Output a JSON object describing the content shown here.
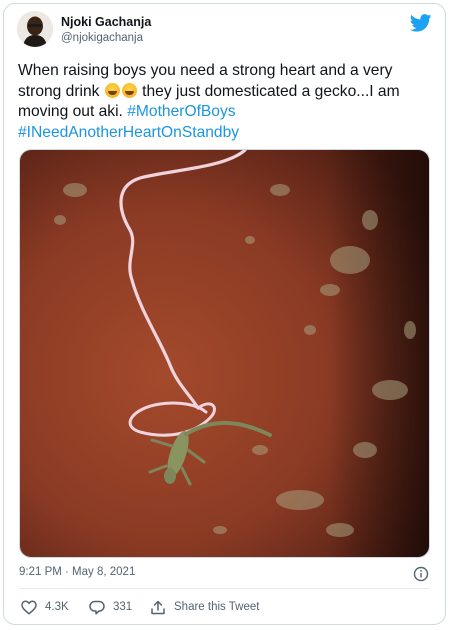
{
  "tweet": {
    "author_name": "Njoki Gachanja",
    "author_handle": "@njokigachanja",
    "text_part1": "When raising boys you need a strong heart and a very strong drink",
    "emojis": [
      "grinning-sweat-emoji",
      "grinning-sweat-emoji"
    ],
    "text_part2": "they just domesticated a gecko...I am moving out aki.",
    "hashtags": [
      "#MotherOfBoys",
      "#INeedAnotherHeartOnStandby"
    ],
    "timestamp": "9:21 PM · May 8, 2021"
  },
  "actions": {
    "likes": "4.3K",
    "replies": "331",
    "share_label": "Share this Tweet"
  },
  "icons": {
    "brand": "twitter-bird-icon",
    "info": "info-icon",
    "like": "heart-icon",
    "reply": "reply-bubble-icon",
    "share": "share-icon"
  },
  "colors": {
    "brand_blue": "#1da1f2",
    "hashtag": "#1b95e0",
    "secondary_text": "#536471",
    "photo_wall": "#8a3a24"
  }
}
